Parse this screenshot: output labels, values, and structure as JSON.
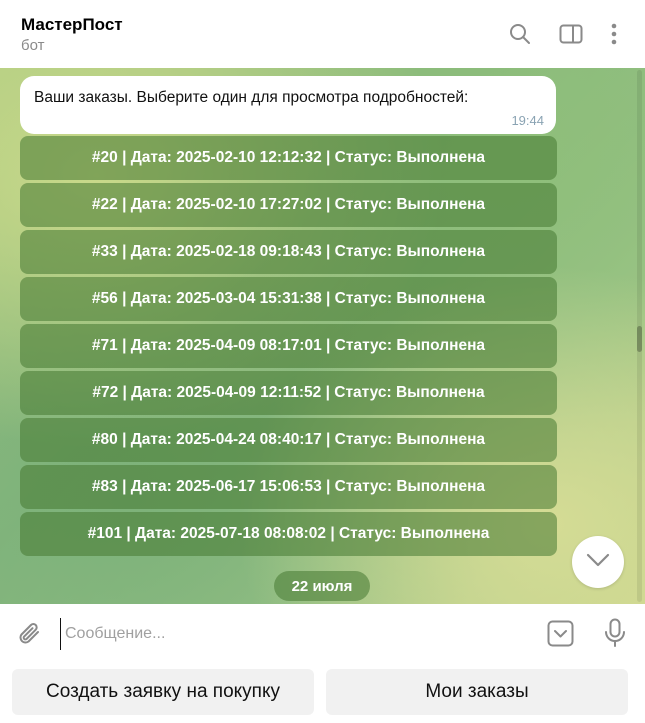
{
  "header": {
    "title": "МастерПост",
    "subtitle": "бот",
    "icons": [
      "search-icon",
      "sidebar-icon",
      "more-icon"
    ]
  },
  "chat": {
    "message": {
      "text": "Ваши заказы. Выберите один для просмотра подробностей:",
      "time": "19:44"
    },
    "orders": [
      "#20 | Дата: 2025-02-10 12:12:32 | Статус: Выполнена",
      "#22 | Дата: 2025-02-10 17:27:02 | Статус: Выполнена",
      "#33 | Дата: 2025-02-18 09:18:43 | Статус: Выполнена",
      "#56 | Дата: 2025-03-04 15:31:38 | Статус: Выполнена",
      "#71 | Дата: 2025-04-09 08:17:01 | Статус: Выполнена",
      "#72 | Дата: 2025-04-09 12:11:52 | Статус: Выполнена",
      "#80 | Дата: 2025-04-24 08:40:17 | Статус: Выполнена",
      "#83 | Дата: 2025-06-17 15:06:53 | Статус: Выполнена",
      "#101 | Дата: 2025-07-18 08:08:02 | Статус: Выполнена"
    ],
    "date_separator": "22 июля"
  },
  "input": {
    "placeholder": "Сообщение..."
  },
  "keyboard": {
    "left_button": "Создать заявку на покупку",
    "right_button": "Мои заказы"
  },
  "colors": {
    "button_bg": "#5a8a3f",
    "accent": "#8aa3b3"
  }
}
